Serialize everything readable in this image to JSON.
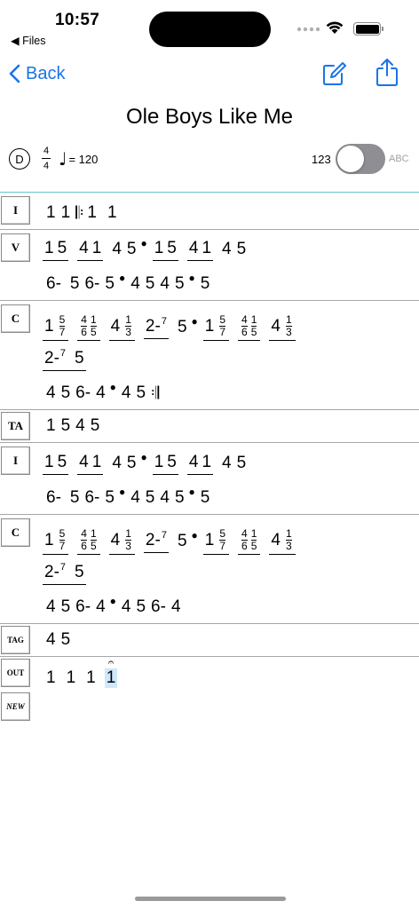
{
  "status": {
    "time": "10:57",
    "back_app": "Files"
  },
  "nav": {
    "back_label": "Back"
  },
  "song": {
    "title": "Ole Boys Like Me",
    "key": "D",
    "time_top": "4",
    "time_bottom": "4",
    "tempo_equals": "= 120"
  },
  "toggle": {
    "left_label": "123",
    "right_label": "ABC",
    "on": false
  },
  "sections": [
    {
      "label": "I"
    },
    {
      "label": "V"
    },
    {
      "label": "C"
    },
    {
      "label": "TA"
    },
    {
      "label": "I"
    },
    {
      "label": "C"
    },
    {
      "label": "TAG"
    },
    {
      "label": "OUT"
    }
  ],
  "new_label": "NEW",
  "icons": [
    "chevron-left-icon",
    "edit-icon",
    "share-icon",
    "wifi-icon",
    "battery-icon",
    "quarter-note-icon",
    "fermata-icon"
  ]
}
